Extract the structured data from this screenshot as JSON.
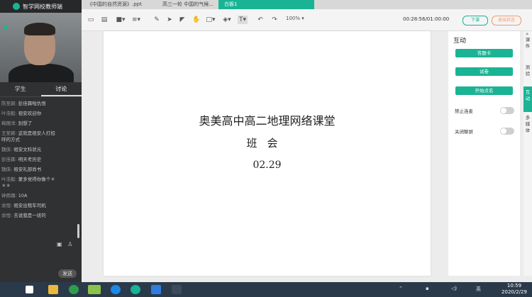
{
  "brand": {
    "name": "智学网校教师端"
  },
  "left_tabs": {
    "students": "学生",
    "discussion": "讨论"
  },
  "chat": [
    {
      "name": "陈至颖:",
      "text": "彭佳霖啦仇恨"
    },
    {
      "name": "叶浩毅:",
      "text": "祖安欢迎你"
    },
    {
      "name": "梅丽洋:",
      "text": "别想了"
    },
    {
      "name": "王至颖:",
      "text": "这就是祖安人打招"
    },
    {
      "name": "",
      "text": "呼的方式"
    },
    {
      "name": "魏侠:",
      "text": "祖安文科状元"
    },
    {
      "name": "彭佳霖:",
      "text": "明天考历史"
    },
    {
      "name": "魏侠:",
      "text": "祖安礼部尚书"
    },
    {
      "name": "叶浩毅:",
      "text": "蒙多觉得你像个＊"
    },
    {
      "name": "",
      "text": "＊＊"
    },
    {
      "name": "钟雨璐:",
      "text": "10A"
    },
    {
      "name": "余恒:",
      "text": "祖安出租车司机"
    },
    {
      "name": "余恒:",
      "text": "去说我是一班的"
    }
  ],
  "send_label": "发送",
  "doc_tabs": [
    "《中国的自然资源》.ppt",
    "高三一轮 中国的气候...",
    "白板1"
  ],
  "toolbar": {
    "zoom": "100%",
    "timer": "00:28:56/01:00:00",
    "down_label": "下课",
    "exit_label": "退出状态"
  },
  "slide": {
    "title": "奥美高中高二地理网络课堂",
    "subtitle": "班会",
    "date": "02.29"
  },
  "panel": {
    "header": "互动",
    "buttons": [
      "答题卡",
      "试卷",
      "开始点名"
    ],
    "toggles": [
      {
        "label": "禁止连麦",
        "on": false
      },
      {
        "label": "关闭聊屏",
        "on": false
      }
    ]
  },
  "sidebar": [
    "课件",
    "测验",
    "互动",
    "多媒体"
  ],
  "taskbar": {
    "time": "10:59",
    "date": "2020/2/29",
    "lang": "英"
  },
  "colors": {
    "accent": "#1ab394",
    "warning": "#f29a6e",
    "left_bg": "#2f3133",
    "taskbar": "#2b3a4a"
  }
}
